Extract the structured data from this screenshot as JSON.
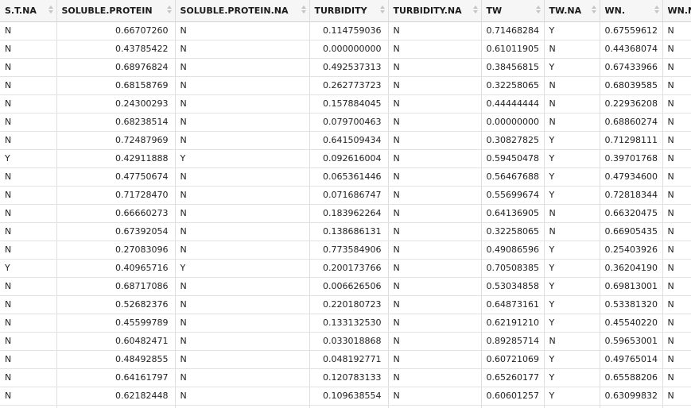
{
  "grid": {
    "columns": [
      {
        "label": "S.T.NA",
        "align": "left"
      },
      {
        "label": "SOLUBLE.PROTEIN",
        "align": "right"
      },
      {
        "label": "SOLUBLE.PROTEIN.NA",
        "align": "left"
      },
      {
        "label": "TURBIDITY",
        "align": "right"
      },
      {
        "label": "TURBIDITY.NA",
        "align": "left"
      },
      {
        "label": "TW",
        "align": "right"
      },
      {
        "label": "TW.NA",
        "align": "left"
      },
      {
        "label": "WN.",
        "align": "right"
      },
      {
        "label": "WN.NA",
        "align": "left"
      }
    ],
    "rows": [
      [
        "N",
        "0.66707260",
        "N",
        "0.114759036",
        "N",
        "0.71468284",
        "Y",
        "0.67559612",
        "N"
      ],
      [
        "N",
        "0.43785422",
        "N",
        "0.000000000",
        "N",
        "0.61011905",
        "N",
        "0.44368074",
        "N"
      ],
      [
        "N",
        "0.68976824",
        "N",
        "0.492537313",
        "N",
        "0.38456815",
        "Y",
        "0.67433966",
        "N"
      ],
      [
        "N",
        "0.68158769",
        "N",
        "0.262773723",
        "N",
        "0.32258065",
        "N",
        "0.68039585",
        "N"
      ],
      [
        "N",
        "0.24300293",
        "N",
        "0.157884045",
        "N",
        "0.44444444",
        "N",
        "0.22936208",
        "N"
      ],
      [
        "N",
        "0.68238514",
        "N",
        "0.079700463",
        "N",
        "0.00000000",
        "N",
        "0.68860274",
        "N"
      ],
      [
        "N",
        "0.72487969",
        "N",
        "0.641509434",
        "N",
        "0.30827825",
        "Y",
        "0.71298111",
        "N"
      ],
      [
        "Y",
        "0.42911888",
        "Y",
        "0.092616004",
        "N",
        "0.59450478",
        "Y",
        "0.39701768",
        "N"
      ],
      [
        "N",
        "0.47750674",
        "N",
        "0.065361446",
        "N",
        "0.56467688",
        "Y",
        "0.47934600",
        "N"
      ],
      [
        "N",
        "0.71728470",
        "N",
        "0.071686747",
        "N",
        "0.55699674",
        "Y",
        "0.72818344",
        "N"
      ],
      [
        "N",
        "0.66660273",
        "N",
        "0.183962264",
        "N",
        "0.64136905",
        "N",
        "0.66320475",
        "N"
      ],
      [
        "N",
        "0.67392054",
        "N",
        "0.138686131",
        "N",
        "0.32258065",
        "N",
        "0.66905435",
        "N"
      ],
      [
        "N",
        "0.27083096",
        "N",
        "0.773584906",
        "N",
        "0.49086596",
        "Y",
        "0.25403926",
        "N"
      ],
      [
        "Y",
        "0.40965716",
        "Y",
        "0.200173766",
        "N",
        "0.70508385",
        "Y",
        "0.36204190",
        "N"
      ],
      [
        "N",
        "0.68717086",
        "N",
        "0.006626506",
        "N",
        "0.53034858",
        "Y",
        "0.69813001",
        "N"
      ],
      [
        "N",
        "0.52682376",
        "N",
        "0.220180723",
        "N",
        "0.64873161",
        "Y",
        "0.53381320",
        "N"
      ],
      [
        "N",
        "0.45599789",
        "N",
        "0.133132530",
        "N",
        "0.62191210",
        "Y",
        "0.45540220",
        "N"
      ],
      [
        "N",
        "0.60482471",
        "N",
        "0.033018868",
        "N",
        "0.89285714",
        "N",
        "0.59653001",
        "N"
      ],
      [
        "N",
        "0.48492855",
        "N",
        "0.048192771",
        "N",
        "0.60721069",
        "Y",
        "0.49765014",
        "N"
      ],
      [
        "N",
        "0.64161797",
        "N",
        "0.120783133",
        "N",
        "0.65260177",
        "Y",
        "0.65588206",
        "N"
      ],
      [
        "N",
        "0.62182448",
        "N",
        "0.109638554",
        "N",
        "0.60601257",
        "Y",
        "0.63099832",
        "N"
      ],
      [
        "",
        "",
        "",
        "",
        "",
        "",
        "",
        "",
        ""
      ]
    ]
  }
}
